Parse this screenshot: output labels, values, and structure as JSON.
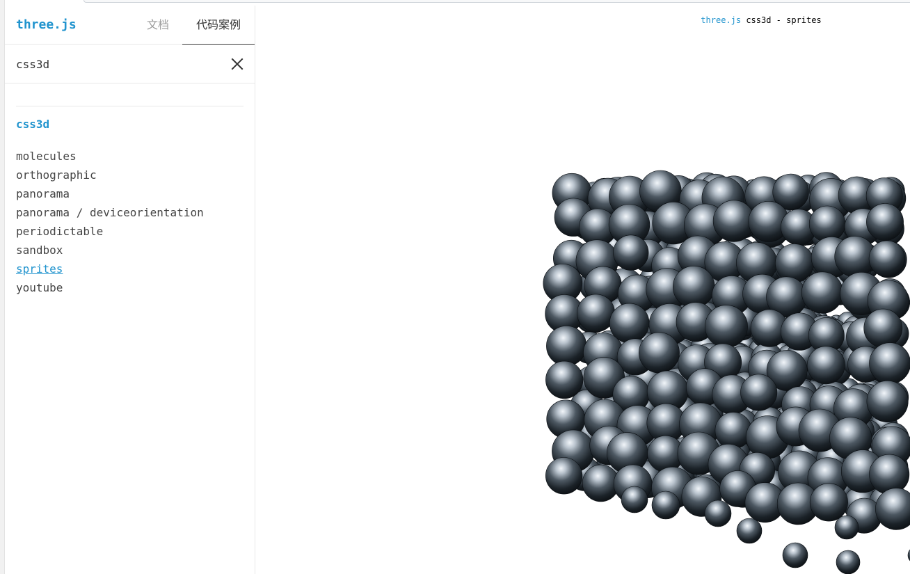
{
  "header": {
    "logo": "three.js",
    "tabs": [
      {
        "label": "文档"
      },
      {
        "label": "代码案例"
      }
    ]
  },
  "search": {
    "value": "css3d"
  },
  "category": "css3d",
  "examples": [
    {
      "label": "molecules"
    },
    {
      "label": "orthographic"
    },
    {
      "label": "panorama"
    },
    {
      "label": "panorama / deviceorientation"
    },
    {
      "label": "periodictable"
    },
    {
      "label": "sandbox"
    },
    {
      "label": "sprites",
      "selected": true
    },
    {
      "label": "youtube"
    }
  ],
  "viewport": {
    "info_link": "three.js",
    "info_text": " css3d - sprites"
  },
  "icons": {
    "clear": "close-icon"
  },
  "colors": {
    "accent": "#2194ce",
    "text": "#444444",
    "tab_inactive": "#9b9b9b"
  }
}
